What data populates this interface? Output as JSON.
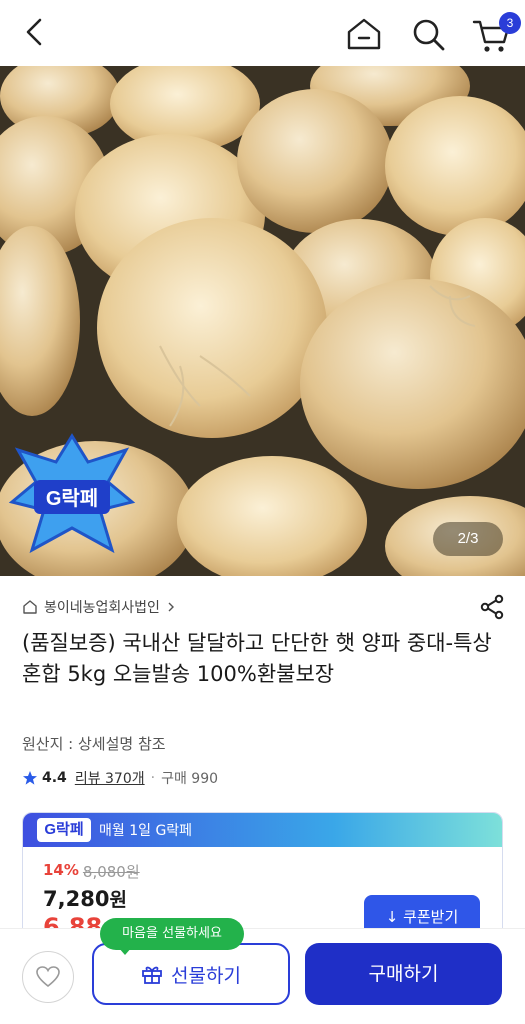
{
  "header": {
    "back_icon": "chevron-left-icon",
    "home_icon": "home-icon",
    "search_icon": "search-icon",
    "cart_icon": "cart-icon",
    "cart_count": "3"
  },
  "hero": {
    "page_indicator": "2/3",
    "badge_text": "G락페"
  },
  "product": {
    "seller": "봉이네농업회사법인",
    "title": "(품질보증) 국내산 달달하고 단단한 햇 양파 중대-특상 혼합 5kg 오늘발송 100%환불보장",
    "origin": "원산지 : 상세설명 참조",
    "rating": "4.4",
    "reviews": "리뷰 370개",
    "purchases": "구매 990"
  },
  "deal": {
    "logo": "G락페",
    "banner": "매월 1일 G락페",
    "discount_pct": "14%",
    "original_price": "8,080원",
    "price": "7,280",
    "price_unit": "원",
    "second_price": "6,88",
    "coupon_label": "쿠폰받기"
  },
  "bottom": {
    "tooltip": "마음을 선물하세요",
    "gift_label": "선물하기",
    "buy_label": "구매하기"
  },
  "colors": {
    "brand": "#2a3dd8",
    "sale": "#e8433a",
    "tooltip": "#23b24b"
  }
}
